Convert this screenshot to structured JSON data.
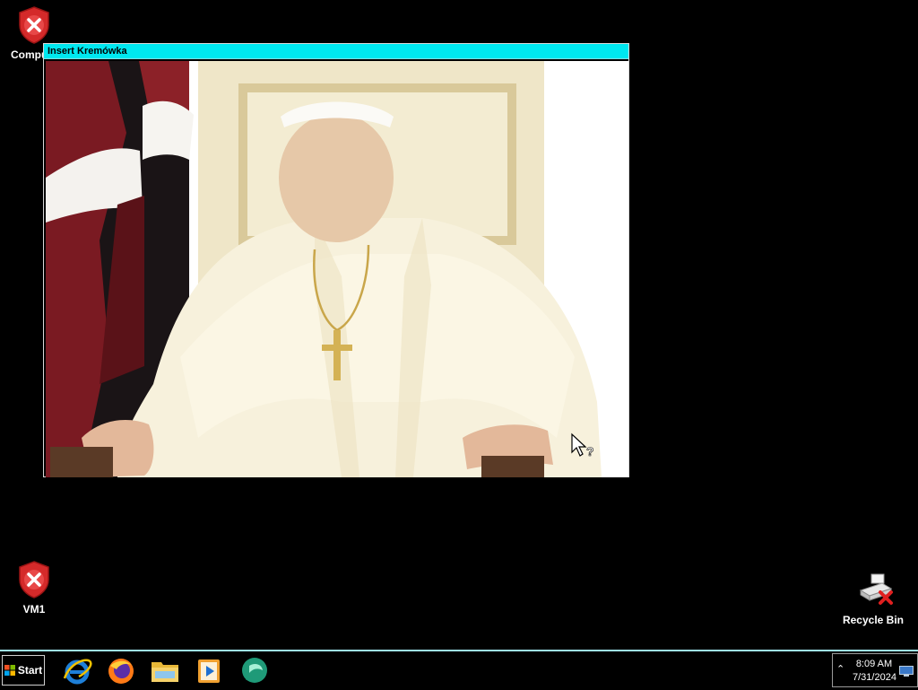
{
  "desktop": {
    "icons": [
      {
        "label": "Compu",
        "icon": "shield-x-icon"
      },
      {
        "label": "VM1",
        "icon": "shield-x-icon"
      },
      {
        "label": "Recycle Bin",
        "icon": "recycle-bin-x-icon"
      }
    ]
  },
  "window": {
    "title": "Insert Kremówka",
    "content": "photo of a seated person in white vestments"
  },
  "taskbar": {
    "start_label": "Start",
    "apps": [
      {
        "icon": "internet-explorer-icon"
      },
      {
        "icon": "firefox-icon"
      },
      {
        "icon": "file-explorer-icon"
      },
      {
        "icon": "media-player-icon"
      },
      {
        "icon": "chat-app-icon"
      }
    ],
    "clock": {
      "time": "8:09 AM",
      "date": "7/31/2024"
    }
  },
  "colors": {
    "titlebar": "#00e8f0",
    "desktop": "#000000",
    "taskbar_border": "#9fe6f0"
  }
}
